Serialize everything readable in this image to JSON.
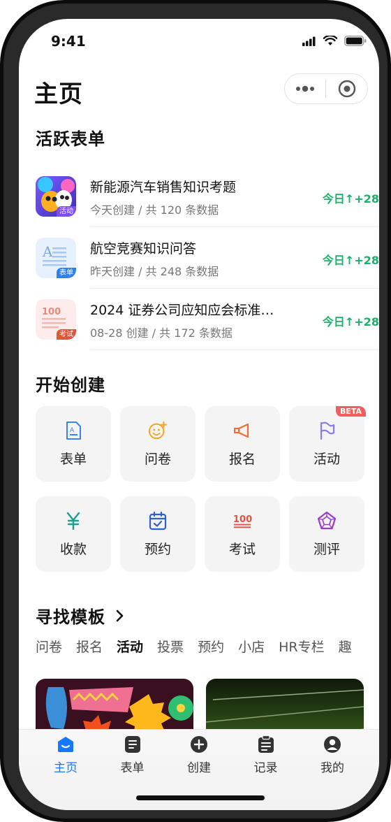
{
  "status_bar": {
    "time": "9:41"
  },
  "header": {
    "title": "主页"
  },
  "active_forms": {
    "title": "活跃表单",
    "items": [
      {
        "title": "新能源汽车销售知识考题",
        "subtitle": "今天创建 / 共 120 条数据",
        "stat": "今日↑+28",
        "tag": "活动",
        "icon": "activity-thumbnail"
      },
      {
        "title": "航空竞赛知识问答",
        "subtitle": "昨天创建 / 共 248 条数据",
        "stat": "今日↑+28",
        "tag": "表单",
        "icon": "form-thumbnail"
      },
      {
        "title": "2024 证券公司应知应会标准…",
        "subtitle": "08-28 创建 / 共 172 条数据",
        "stat": "今日↑+28",
        "tag": "考试",
        "icon": "exam-thumbnail"
      }
    ]
  },
  "create": {
    "title": "开始创建",
    "tiles": [
      {
        "label": "表单",
        "icon": "form-icon",
        "color": "#3b82f6"
      },
      {
        "label": "问卷",
        "icon": "smiley-icon",
        "color": "#f5a623"
      },
      {
        "label": "报名",
        "icon": "megaphone-icon",
        "color": "#f26b3a"
      },
      {
        "label": "活动",
        "icon": "flag-icon",
        "color": "#8b7cf6",
        "badge": "BETA"
      },
      {
        "label": "收款",
        "icon": "yuan-icon",
        "color": "#1f9d8f"
      },
      {
        "label": "预约",
        "icon": "calendar-check-icon",
        "color": "#2f5fd0"
      },
      {
        "label": "考试",
        "icon": "score-100-icon",
        "color": "#e0533d"
      },
      {
        "label": "测评",
        "icon": "pentagon-icon",
        "color": "#9b3ad6"
      }
    ]
  },
  "templates": {
    "title": "寻找模板",
    "tabs": [
      "问卷",
      "报名",
      "活动",
      "投票",
      "预约",
      "小店",
      "HR专栏",
      "趣"
    ],
    "active_tab": "活动"
  },
  "tabbar": {
    "items": [
      {
        "label": "主页",
        "icon": "home-icon",
        "active": true
      },
      {
        "label": "表单",
        "icon": "form-list-icon",
        "active": false
      },
      {
        "label": "创建",
        "icon": "plus-circle-icon",
        "active": false
      },
      {
        "label": "记录",
        "icon": "clipboard-icon",
        "active": false
      },
      {
        "label": "我的",
        "icon": "user-icon",
        "active": false
      }
    ],
    "active_color": "#1677ff"
  }
}
